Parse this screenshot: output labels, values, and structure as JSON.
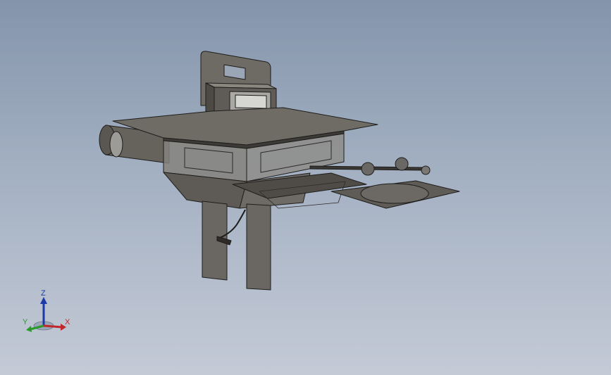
{
  "triad": {
    "x_label": "X",
    "y_label": "Y",
    "z_label": "Z",
    "x_color": "#c0282a",
    "y_color": "#2a9a2a",
    "z_color": "#1e3aa8"
  },
  "model": {
    "body_color": "#6b6862",
    "edge_color": "#1e1d1b",
    "glass_color": "#9a9a98",
    "highlight_color": "#bdbcb8"
  },
  "viewport": {
    "background_top": "#8494ab",
    "background_bottom": "#c4cad6"
  }
}
